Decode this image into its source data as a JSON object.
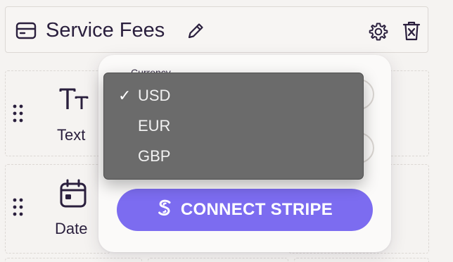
{
  "header": {
    "title": "Service Fees",
    "icons": [
      "credit-card-icon",
      "pencil-icon",
      "gear-icon",
      "trash-icon"
    ]
  },
  "palette": {
    "items": [
      {
        "label": "Text",
        "icon": "text-type-icon"
      },
      {
        "label": "Date",
        "icon": "calendar-icon"
      }
    ]
  },
  "popover": {
    "field_label": "Currency",
    "currency": {
      "selected": "USD",
      "options": [
        "USD",
        "EUR",
        "GBP"
      ]
    },
    "connect_button": {
      "label": "CONNECT STRIPE",
      "icon": "stripe-s-icon"
    }
  },
  "colors": {
    "accent": "#7c6cf0",
    "text": "#2a1f3d",
    "dropdown_bg": "#6b6b6b",
    "background": "#f5f3f1"
  }
}
